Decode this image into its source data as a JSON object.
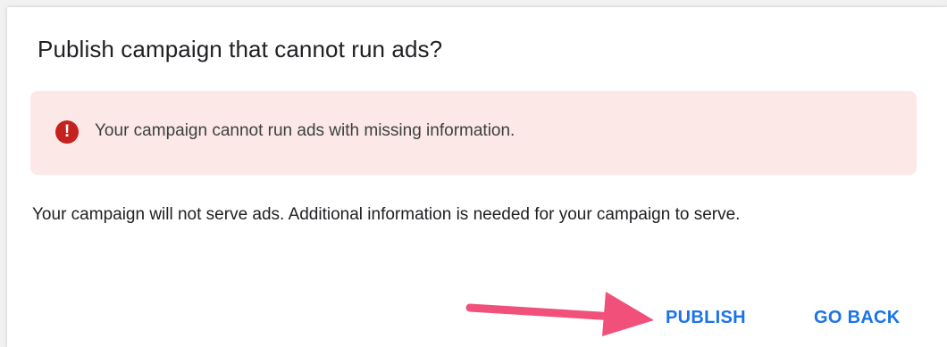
{
  "dialog": {
    "title": "Publish campaign that cannot run ads?",
    "alert": {
      "icon": "error-icon",
      "icon_glyph": "!",
      "message": "Your campaign cannot run ads with missing information.",
      "background_color": "#fce8e6",
      "icon_color": "#c5221f"
    },
    "body": "Your campaign will not serve ads. Additional information is needed for your campaign to serve.",
    "actions": {
      "publish_label": "PUBLISH",
      "go_back_label": "GO BACK",
      "button_color": "#1a73e8"
    }
  },
  "annotation": {
    "icon": "arrow-icon",
    "color": "#f0507a"
  }
}
